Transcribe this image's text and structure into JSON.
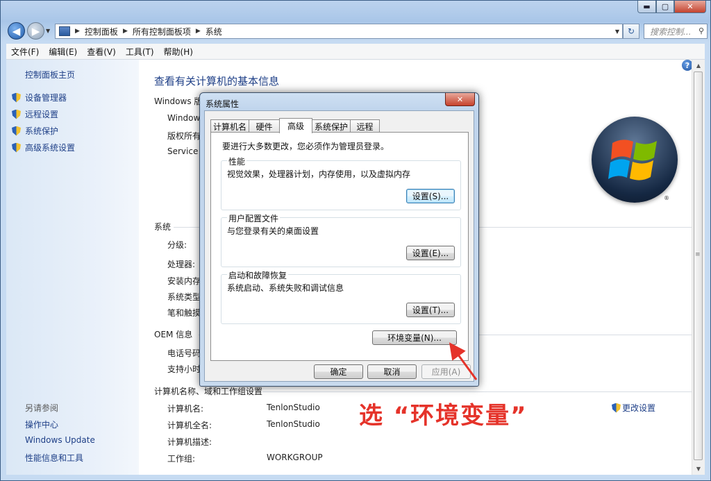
{
  "window": {
    "controls": {
      "minimize": "▬",
      "maximize": "▢",
      "close": "✕"
    }
  },
  "address_bar": {
    "crumbs": [
      "控制面板",
      "所有控制面板项",
      "系统"
    ],
    "search_placeholder": "搜索控制..."
  },
  "menu": [
    "文件(F)",
    "编辑(E)",
    "查看(V)",
    "工具(T)",
    "帮助(H)"
  ],
  "left_pane": {
    "home": "控制面板主页",
    "tasks": [
      "设备管理器",
      "远程设置",
      "系统保护",
      "高级系统设置"
    ],
    "see_also_label": "另请参阅",
    "see_also": [
      "操作中心",
      "Windows Update",
      "性能信息和工具"
    ]
  },
  "main": {
    "title": "查看有关计算机的基本信息",
    "edition_head": "Windows 版",
    "edition_rows": [
      "Windows",
      "版权所有",
      "Service P"
    ],
    "system_head": "系统",
    "system_rows": [
      "分级:",
      "处理器:",
      "安装内存(",
      "系统类型:",
      "笔和触摸:"
    ],
    "oem_head": "OEM 信息",
    "oem_rows": [
      "电话号码",
      "支持小时数"
    ],
    "computer_head": "计算机名称、域和工作组设置",
    "computer_rows": [
      {
        "label": "计算机名:",
        "value": "TenlonStudio"
      },
      {
        "label": "计算机全名:",
        "value": "TenlonStudio"
      },
      {
        "label": "计算机描述:",
        "value": ""
      },
      {
        "label": "工作组:",
        "value": "WORKGROUP"
      }
    ],
    "change_settings": "更改设置",
    "logo_mark": "®",
    "help": "?"
  },
  "dialog": {
    "title": "系统属性",
    "close": "✕",
    "tabs": [
      "计算机名",
      "硬件",
      "高级",
      "系统保护",
      "远程"
    ],
    "active_tab": "高级",
    "admin_note": "要进行大多数更改，您必须作为管理员登录。",
    "groups": [
      {
        "title": "性能",
        "desc": "视觉效果，处理器计划，内存使用，以及虚拟内存",
        "button": "设置(S)..."
      },
      {
        "title": "用户配置文件",
        "desc": "与您登录有关的桌面设置",
        "button": "设置(E)..."
      },
      {
        "title": "启动和故障恢复",
        "desc": "系统启动、系统失败和调试信息",
        "button": "设置(T)..."
      }
    ],
    "env_button": "环境变量(N)...",
    "ok": "确定",
    "cancel": "取消",
    "apply": "应用(A)"
  },
  "annotation": {
    "text": "选 “环境变量”",
    "color": "#e5332a"
  },
  "colors": {
    "link": "#1e3f87",
    "title_bar": "#bcd3ee"
  }
}
